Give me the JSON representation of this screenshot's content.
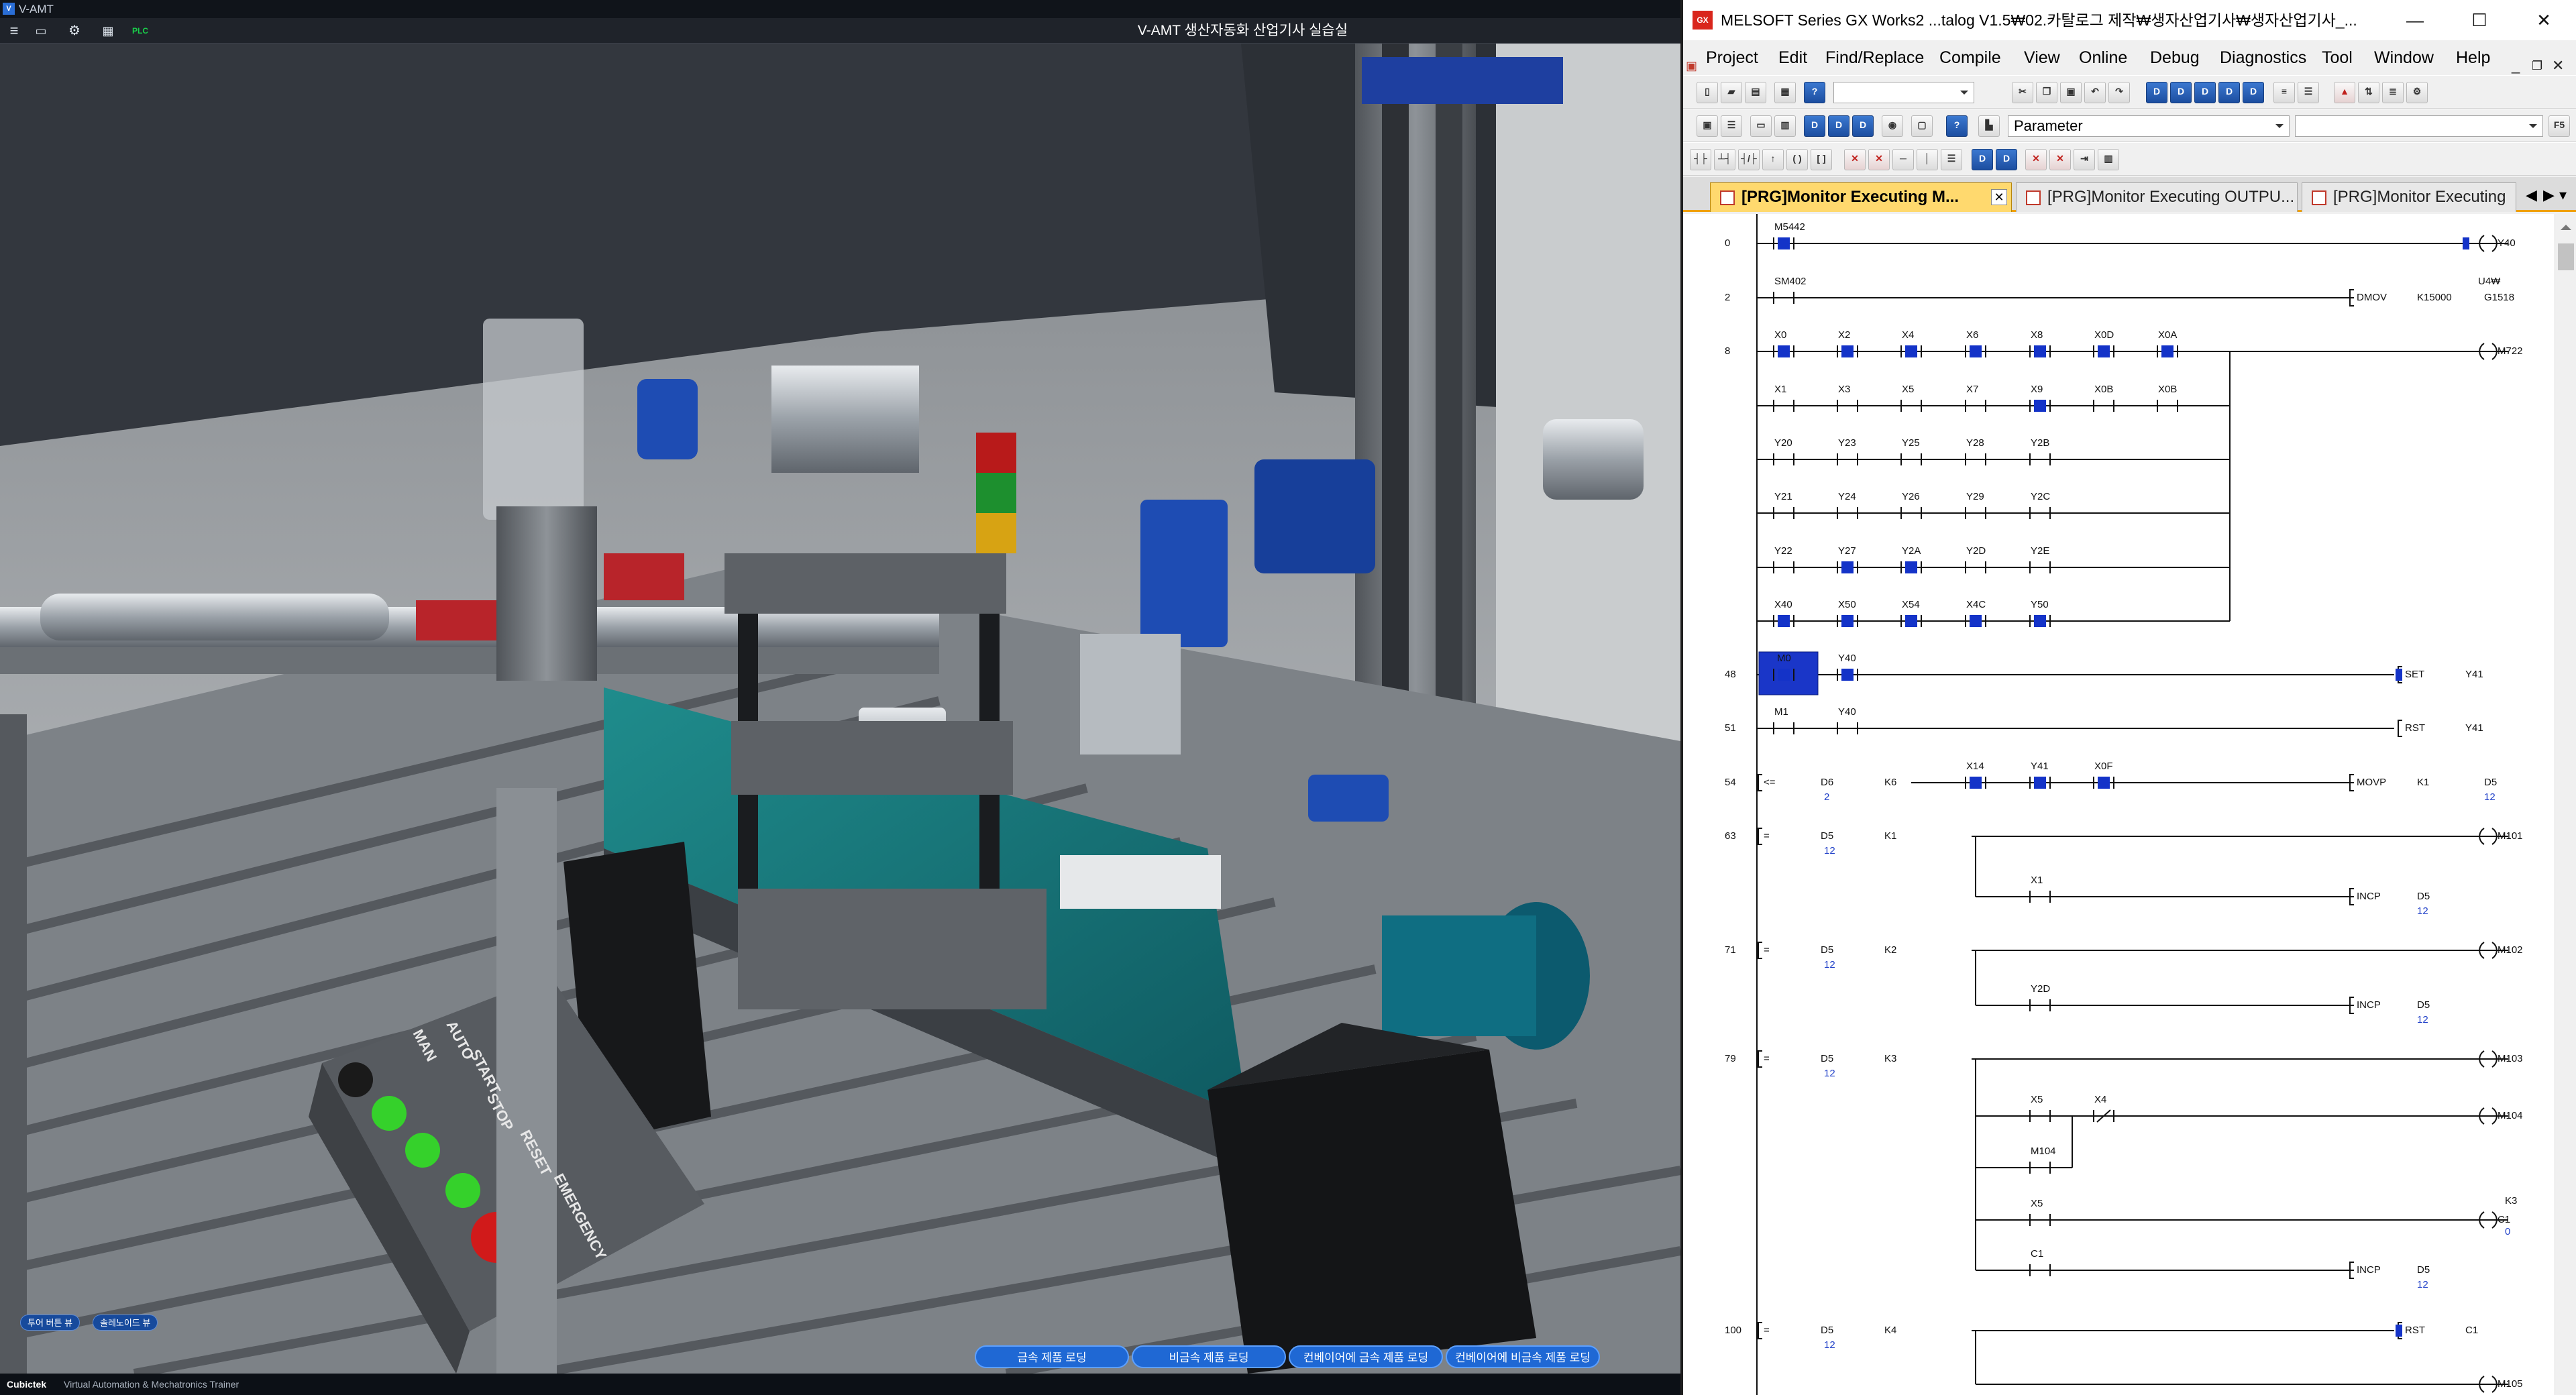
{
  "vamt": {
    "app_label": "V-AMT",
    "scene_title": "V-AMT 생산자동화 산업기사 실습실",
    "toolbar_icons": [
      "menu-icon",
      "document-icon",
      "gear-icon",
      "grid-icon",
      "plc-icon"
    ],
    "side_buttons": [
      "투어 버튼 뷰",
      "솔레노이드 뷰"
    ],
    "panel_labels": [
      "MAN",
      "AUTO",
      "START",
      "STOP",
      "RESET",
      "EMERGENCY"
    ],
    "bottom_buttons": [
      "금속 제품 로딩",
      "비금속 제품 로딩",
      "컨베이어에 금속 제품 로딩",
      "컨베이어에 비금속 제품 로딩"
    ],
    "footer_brand": "Cubictek",
    "footer_text": "Virtual Automation & Mechatronics Trainer"
  },
  "gx": {
    "title": "MELSOFT Series GX Works2 ...talog V1.5₩02.카탈로그 제작₩생자산업기사₩생자산업기사_...",
    "menus": [
      "Project",
      "Edit",
      "Find/Replace",
      "Compile",
      "View",
      "Online",
      "Debug",
      "Diagnostics",
      "Tool",
      "Window",
      "Help"
    ],
    "parameter_combo": "Parameter",
    "tabs": [
      "[PRG]Monitor Executing M...",
      "[PRG]Monitor Executing OUTPU...",
      "[PRG]Monitor Executing"
    ],
    "colors": {
      "energized": "#1433c8",
      "rail": "#111111",
      "active_tab": "#ffd96e"
    },
    "ladder": {
      "steps": [
        "0",
        "2",
        "8",
        "48",
        "51",
        "54",
        "63",
        "71",
        "79",
        "100"
      ],
      "row0": {
        "contact": "M5442",
        "coil": "Y40"
      },
      "row2": {
        "contact": "SM402",
        "instr": "DMOV",
        "src": "K15000",
        "dst_top": "U4₩",
        "dst": "G1518"
      },
      "row8": {
        "r1": [
          "X0",
          "X2",
          "X4",
          "X6",
          "X8",
          "X0D",
          "X0A"
        ],
        "r2": [
          "X1",
          "X3",
          "X5",
          "X7",
          "X9",
          "X0B",
          "X0B"
        ],
        "r3": [
          "Y20",
          "Y23",
          "Y25",
          "Y28",
          "Y2B"
        ],
        "r4": [
          "Y21",
          "Y24",
          "Y26",
          "Y29",
          "Y2C"
        ],
        "r5": [
          "Y22",
          "Y27",
          "Y2A",
          "Y2D",
          "Y2E"
        ],
        "r6": [
          "X40",
          "X50",
          "X54",
          "X4C",
          "Y50"
        ],
        "coil": "M722"
      },
      "row48": {
        "c1": "M0",
        "c2": "Y40",
        "instr": "SET",
        "dev": "Y41"
      },
      "row51": {
        "c1": "M1",
        "c2": "Y40",
        "instr": "RST",
        "dev": "Y41"
      },
      "row54": {
        "cmp": "<=",
        "a": "D6",
        "a_val": "2",
        "b": "K6",
        "c1": "X14",
        "c2": "Y41",
        "c3": "X0F",
        "instr": "MOVP",
        "src": "K1",
        "dst": "D5",
        "dst_val": "12"
      },
      "row63": {
        "cmp": "=",
        "a": "D5",
        "a_val": "12",
        "b": "K1",
        "coil": "M101",
        "sub": "X1",
        "instr": "INCP",
        "dev": "D5",
        "dev_val": "12"
      },
      "row71": {
        "cmp": "=",
        "a": "D5",
        "a_val": "12",
        "b": "K2",
        "coil": "M102",
        "sub": "Y2D",
        "instr": "INCP",
        "dev": "D5",
        "dev_val": "12"
      },
      "row79": {
        "cmp": "=",
        "a": "D5",
        "a_val": "12",
        "b": "K3",
        "coil": "M103",
        "s1": "X5",
        "s2": "X4",
        "coil2": "M104",
        "hold": "M104",
        "s3": "X5",
        "cnt": "C1",
        "k": "K3",
        "cnt_val": "0",
        "s4": "C1",
        "instr": "INCP",
        "dev": "D5",
        "dev_val": "12"
      },
      "row100": {
        "cmp": "=",
        "a": "D5",
        "a_val": "12",
        "b": "K4",
        "instr": "RST",
        "dev": "C1",
        "coil": "M105"
      }
    }
  }
}
